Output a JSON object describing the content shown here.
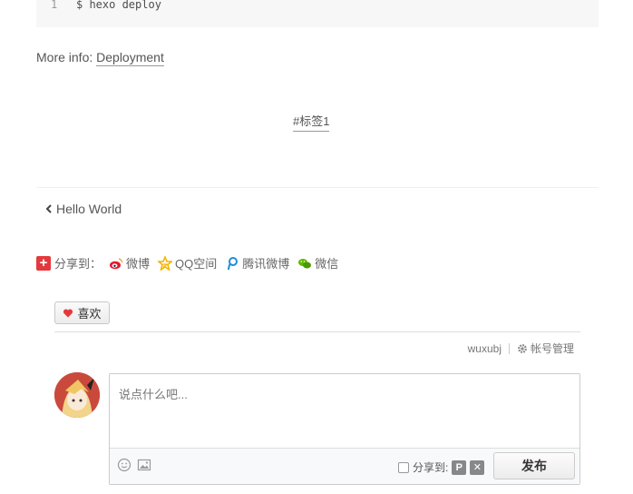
{
  "code": {
    "line_number": "1",
    "command": "$ hexo deploy"
  },
  "more_info": {
    "label": "More info:",
    "link_text": "Deployment"
  },
  "tag": "#标签1",
  "post_nav": {
    "prev_title": "Hello World",
    "prev_icon": "chevron-left-icon"
  },
  "share": {
    "label": "分享到：",
    "items": [
      {
        "label": "微博",
        "icon": "weibo-icon",
        "color": "#e6162d"
      },
      {
        "label": "QQ空间",
        "icon": "qzone-icon",
        "color": "#f5b400"
      },
      {
        "label": "腾讯微博",
        "icon": "tencent-weibo-icon",
        "color": "#1f8ddb"
      },
      {
        "label": "微信",
        "icon": "wechat-icon",
        "color": "#62b900"
      }
    ]
  },
  "like": {
    "label": "喜欢",
    "icon": "heart-icon",
    "color": "#e4393c"
  },
  "account": {
    "username": "wuxubj",
    "manage_label": "帐号管理"
  },
  "comment": {
    "placeholder": "说点什么吧...",
    "share_label": "分享到:",
    "submit_label": "发布"
  }
}
